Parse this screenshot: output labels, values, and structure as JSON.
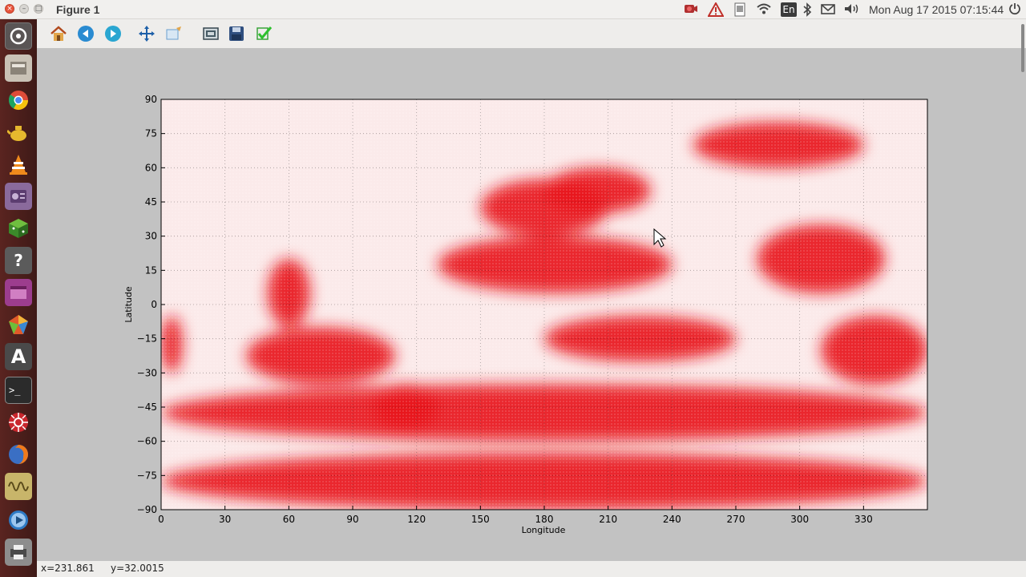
{
  "window": {
    "title": "Figure 1",
    "close_icon": "×",
    "minimize_icon": "–",
    "maximize_icon": "□"
  },
  "top_panel": {
    "keyboard_layout": "En",
    "clock": "Mon Aug 17 2015 07:15:44",
    "indicators": [
      "record-icon",
      "warning-icon",
      "document-icon",
      "wifi-icon",
      "keyboard-icon",
      "bluetooth-icon",
      "mail-icon",
      "volume-icon",
      "power-icon"
    ]
  },
  "launcher": {
    "items": [
      "dash-icon",
      "files-icon",
      "chrome-icon",
      "teapot-icon",
      "vlc-icon",
      "media-icon",
      "cube-icon",
      "help-icon",
      "app-icon",
      "ubuntu-software-icon",
      "font-icon",
      "terminal-icon",
      "settings-icon",
      "firefox-icon",
      "wave-icon",
      "media-player-icon",
      "print-icon"
    ],
    "font_label": "A",
    "help_label": "?",
    "terminal_label": ">_"
  },
  "toolbar": {
    "buttons": [
      "home",
      "back",
      "forward",
      "pan",
      "zoom",
      "subplots",
      "save",
      "check"
    ]
  },
  "status": {
    "x_readout": "x=231.861",
    "y_readout": "y=32.0015"
  },
  "chart_data": {
    "type": "heatmap",
    "title": "",
    "xlabel": "Longitude",
    "ylabel": "Latitude",
    "xlim": [
      0,
      360
    ],
    "ylim": [
      -90,
      90
    ],
    "x_ticks": [
      "0",
      "30",
      "60",
      "90",
      "120",
      "150",
      "180",
      "210",
      "240",
      "270",
      "300",
      "330"
    ],
    "y_ticks": [
      "90",
      "75",
      "60",
      "45",
      "30",
      "15",
      "0",
      "−15",
      "−30",
      "−45",
      "−60",
      "−75",
      "−90"
    ],
    "colormap": "white to red",
    "colors": {
      "low": "#ffffff",
      "high": "#e8141e"
    },
    "grid": true,
    "red_regions": [
      {
        "lon": [
          130,
          240
        ],
        "lat": [
          5,
          30
        ]
      },
      {
        "lon": [
          150,
          210
        ],
        "lat": [
          30,
          55
        ]
      },
      {
        "lon": [
          50,
          70
        ],
        "lat": [
          -10,
          20
        ]
      },
      {
        "lon": [
          40,
          110
        ],
        "lat": [
          -10,
          -35
        ]
      },
      {
        "lon": [
          180,
          270
        ],
        "lat": [
          -5,
          -25
        ]
      },
      {
        "lon": [
          280,
          340
        ],
        "lat": [
          5,
          35
        ]
      },
      {
        "lon": [
          310,
          360
        ],
        "lat": [
          -5,
          -35
        ]
      },
      {
        "lon": [
          0,
          360
        ],
        "lat": [
          -35,
          -60
        ]
      },
      {
        "lon": [
          0,
          360
        ],
        "lat": [
          -65,
          -90
        ]
      },
      {
        "lon": [
          0,
          10
        ],
        "lat": [
          -5,
          -30
        ]
      },
      {
        "lon": [
          100,
          130
        ],
        "lat": [
          -35,
          -55
        ]
      },
      {
        "lon": [
          180,
          230
        ],
        "lat": [
          40,
          60
        ]
      },
      {
        "lon": [
          250,
          330
        ],
        "lat": [
          60,
          80
        ]
      }
    ]
  }
}
